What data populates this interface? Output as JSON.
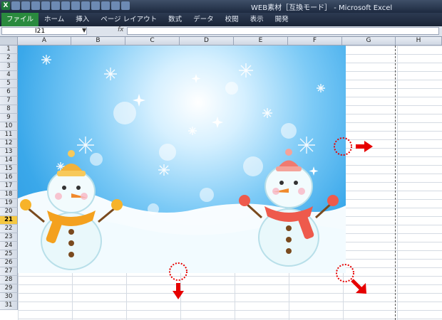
{
  "window": {
    "title": "WEB素材［互換モード］ - Microsoft Excel"
  },
  "ribbon": {
    "tabs": [
      {
        "label": "ファイル"
      },
      {
        "label": "ホーム"
      },
      {
        "label": "挿入"
      },
      {
        "label": "ページ レイアウト"
      },
      {
        "label": "数式"
      },
      {
        "label": "データ"
      },
      {
        "label": "校閲"
      },
      {
        "label": "表示"
      },
      {
        "label": "開発"
      }
    ]
  },
  "formula_bar": {
    "name_box": "I21",
    "fx": "fx",
    "value": ""
  },
  "columns": [
    "A",
    "B",
    "C",
    "D",
    "E",
    "F",
    "G",
    "H"
  ],
  "rows": [
    "1",
    "2",
    "3",
    "4",
    "5",
    "6",
    "7",
    "8",
    "9",
    "10",
    "11",
    "12",
    "13",
    "14",
    "15",
    "16",
    "17",
    "18",
    "19",
    "20",
    "21",
    "22",
    "23",
    "24",
    "25",
    "26",
    "27",
    "28",
    "29",
    "30",
    "31"
  ],
  "active_row": "21",
  "colors": {
    "accent_file_tab": "#2a8a3e",
    "annotation_red": "#e60000",
    "active_header": "#f5c842"
  },
  "picture": {
    "subject": "snowmen winter background",
    "icons": [
      "snowman-left-icon",
      "snowman-right-icon",
      "snowflake-icon",
      "sparkle-icon"
    ]
  }
}
